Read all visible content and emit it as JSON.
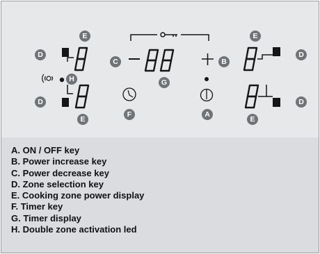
{
  "panel": {
    "badges": {
      "on_off": "A",
      "power_increase": "B",
      "power_decrease": "C",
      "zone_select": "D",
      "zone_display": "E",
      "timer_key": "F",
      "timer_display": "G",
      "double_zone_led": "H"
    },
    "icons": {
      "lock": "key-lock-icon",
      "timer": "clock-icon",
      "power": "power-icon",
      "double_zone": "double-zone-icon",
      "minus": "minus-icon",
      "plus": "plus-icon"
    },
    "colors": {
      "panel_bg": "#e6e8ea",
      "legend_bg": "#dadcdf",
      "badge": "#707377",
      "segment": "#161616"
    }
  },
  "legend": {
    "items": [
      "A. ON / OFF key",
      "B. Power increase key",
      "C. Power decrease key",
      "D. Zone selection key",
      "E. Cooking zone power display",
      "F.  Timer key",
      "G. Timer display",
      "H. Double zone activation led"
    ]
  }
}
